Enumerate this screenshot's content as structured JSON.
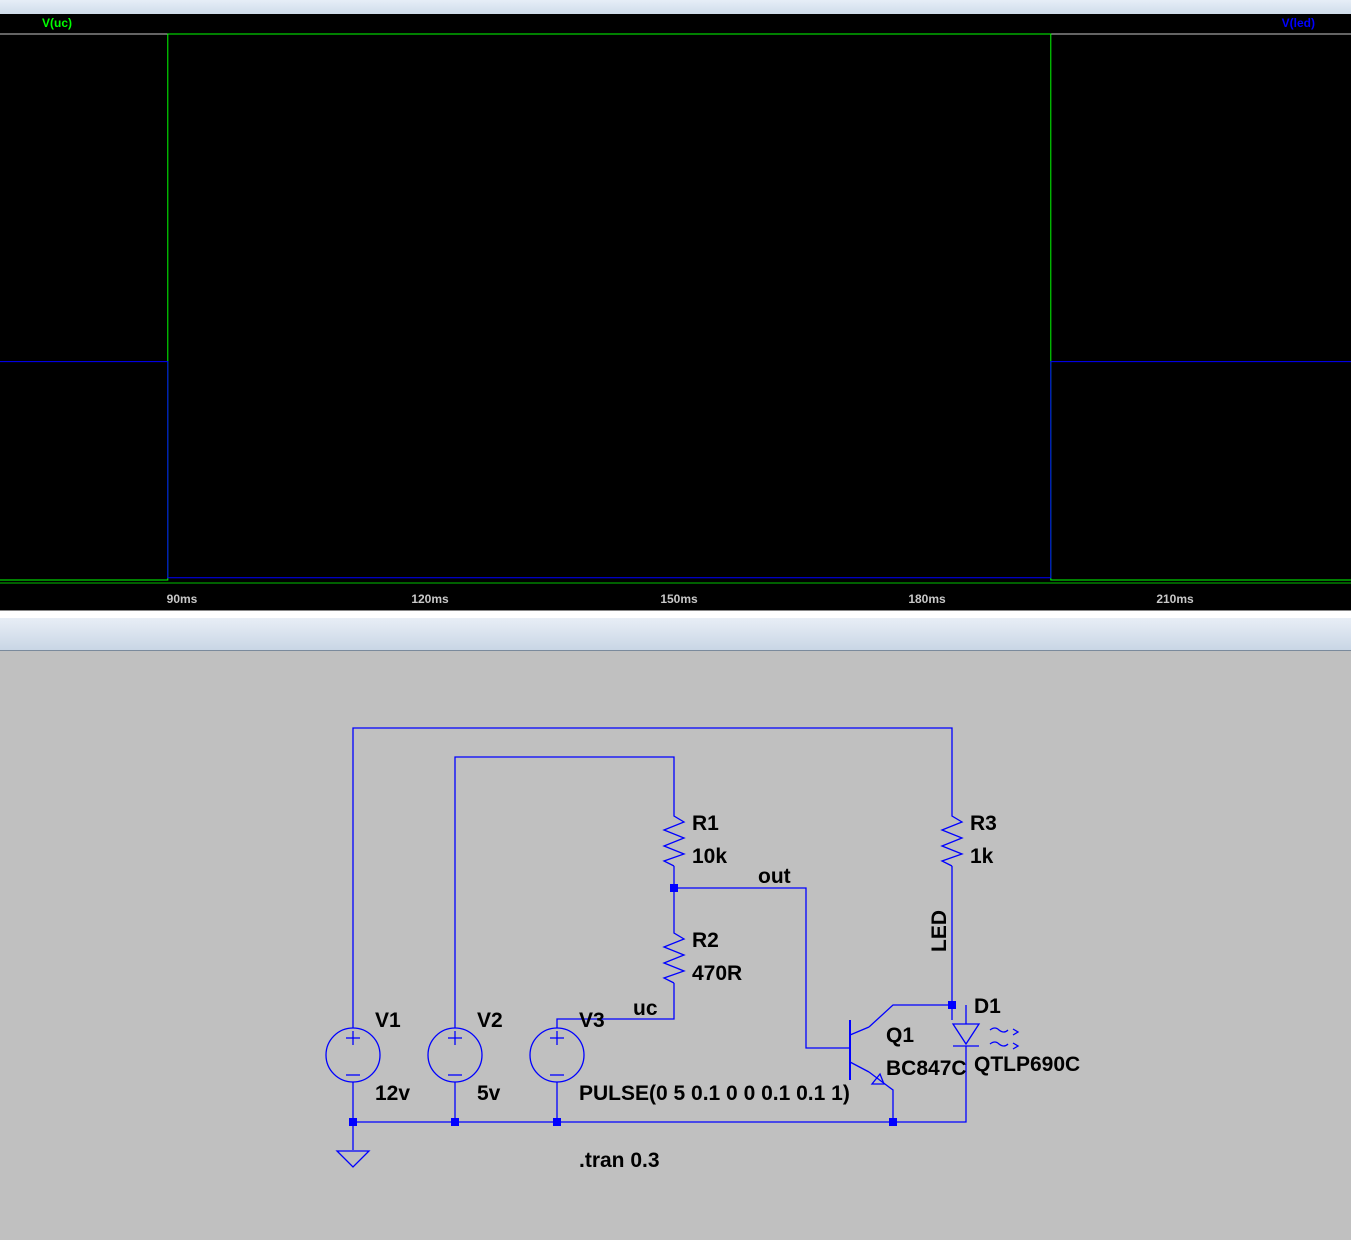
{
  "waveform": {
    "traces": [
      {
        "name": "V(uc)",
        "color": "#00ff00"
      },
      {
        "name": "V(led)",
        "color": "#0000ff"
      }
    ],
    "x_ticks": [
      "90ms",
      "120ms",
      "150ms",
      "180ms",
      "210ms"
    ]
  },
  "chart_data": {
    "type": "line",
    "x_unit": "ms",
    "xlim": [
      81,
      234
    ],
    "xticks": [
      90,
      120,
      150,
      180,
      210
    ],
    "series": [
      {
        "name": "V(uc)",
        "color": "#00ff00",
        "x": [
          81,
          100,
          100,
          200,
          200,
          234
        ],
        "y": [
          0,
          0,
          5,
          5,
          0,
          0
        ]
      },
      {
        "name": "V(led)",
        "color": "#0000ff",
        "x": [
          81,
          100,
          100,
          200,
          200,
          234
        ],
        "y": [
          2.0,
          2.0,
          0.02,
          0.02,
          2.0,
          2.0
        ]
      }
    ]
  },
  "schematic": {
    "components": {
      "V1": {
        "name": "V1",
        "value": "12v"
      },
      "V2": {
        "name": "V2",
        "value": "5v"
      },
      "V3": {
        "name": "V3",
        "value": "PULSE(0 5 0.1 0 0 0.1 0.1 1)"
      },
      "R1": {
        "name": "R1",
        "value": "10k"
      },
      "R2": {
        "name": "R2",
        "value": "470R"
      },
      "R3": {
        "name": "R3",
        "value": "1k"
      },
      "Q1": {
        "name": "Q1",
        "value": "BC847C"
      },
      "D1": {
        "name": "D1",
        "value": "QTLP690C"
      }
    },
    "net_labels": {
      "out": "out",
      "uc": "uc",
      "led": "LED"
    },
    "directive": ".tran 0.3",
    "wire_color": "#0000ff"
  }
}
